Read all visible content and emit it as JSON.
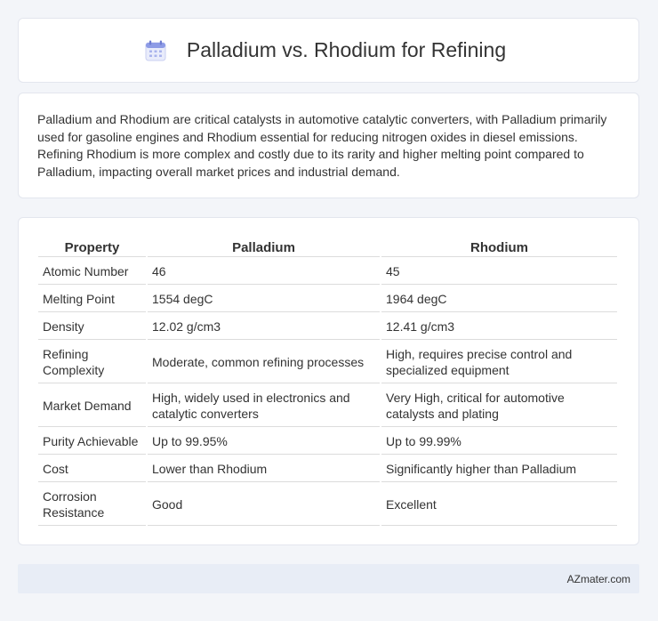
{
  "header": {
    "title": "Palladium vs. Rhodium for Refining",
    "icon": "calendar-icon"
  },
  "intro": {
    "text": "Palladium and Rhodium are critical catalysts in automotive catalytic converters, with Palladium primarily used for gasoline engines and Rhodium essential for reducing nitrogen oxides in diesel emissions. Refining Rhodium is more complex and costly due to its rarity and higher melting point compared to Palladium, impacting overall market prices and industrial demand."
  },
  "table": {
    "headers": [
      "Property",
      "Palladium",
      "Rhodium"
    ],
    "rows": [
      [
        "Atomic Number",
        "46",
        "45"
      ],
      [
        "Melting Point",
        "1554 degC",
        "1964 degC"
      ],
      [
        "Density",
        "12.02 g/cm3",
        "12.41 g/cm3"
      ],
      [
        "Refining Complexity",
        "Moderate, common refining processes",
        "High, requires precise control and specialized equipment"
      ],
      [
        "Market Demand",
        "High, widely used in electronics and catalytic converters",
        "Very High, critical for automotive catalysts and plating"
      ],
      [
        "Purity Achievable",
        "Up to 99.95%",
        "Up to 99.99%"
      ],
      [
        "Cost",
        "Lower than Rhodium",
        "Significantly higher than Palladium"
      ],
      [
        "Corrosion Resistance",
        "Good",
        "Excellent"
      ]
    ]
  },
  "footer": {
    "text": "AZmater.com"
  },
  "colors": {
    "background": "#f3f5f9",
    "footer_bg": "#e8edf6",
    "icon_accent": "#7b8fe0"
  }
}
